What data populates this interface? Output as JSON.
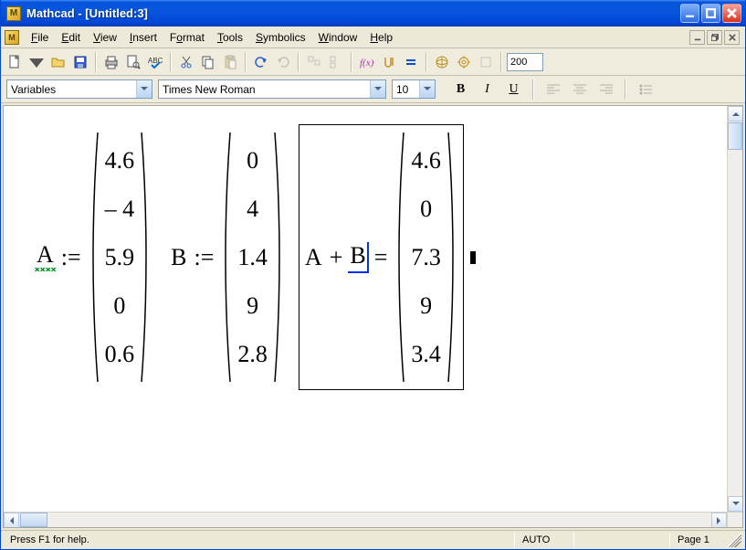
{
  "window": {
    "title": "Mathcad - [Untitled:3]",
    "app_icon_letter": "M"
  },
  "menu": {
    "items": [
      {
        "label": "File",
        "u": "F"
      },
      {
        "label": "Edit",
        "u": "E"
      },
      {
        "label": "View",
        "u": "V"
      },
      {
        "label": "Insert",
        "u": "I"
      },
      {
        "label": "Format",
        "u": "o"
      },
      {
        "label": "Tools",
        "u": "T"
      },
      {
        "label": "Symbolics",
        "u": "S"
      },
      {
        "label": "Window",
        "u": "W"
      },
      {
        "label": "Help",
        "u": "H"
      }
    ]
  },
  "toolbar": {
    "zoom": "200"
  },
  "format": {
    "style": "Variables",
    "font": "Times New Roman",
    "size": "10",
    "bold": "B",
    "italic": "I",
    "underline": "U"
  },
  "math": {
    "regionA": {
      "var": "A",
      "assign": ":=",
      "values": [
        "4.6",
        "– 4",
        "5.9",
        "0",
        "0.6"
      ]
    },
    "regionB": {
      "var": "B",
      "assign": ":=",
      "values": [
        "0",
        "4",
        "1.4",
        "9",
        "2.8"
      ]
    },
    "regionC": {
      "lhsA": "A",
      "plus": "+",
      "lhsB": "B",
      "eq": "=",
      "values": [
        "4.6",
        "0",
        "7.3",
        "9",
        "3.4"
      ]
    }
  },
  "status": {
    "help": "Press F1 for help.",
    "auto": "AUTO",
    "page": "Page 1"
  }
}
